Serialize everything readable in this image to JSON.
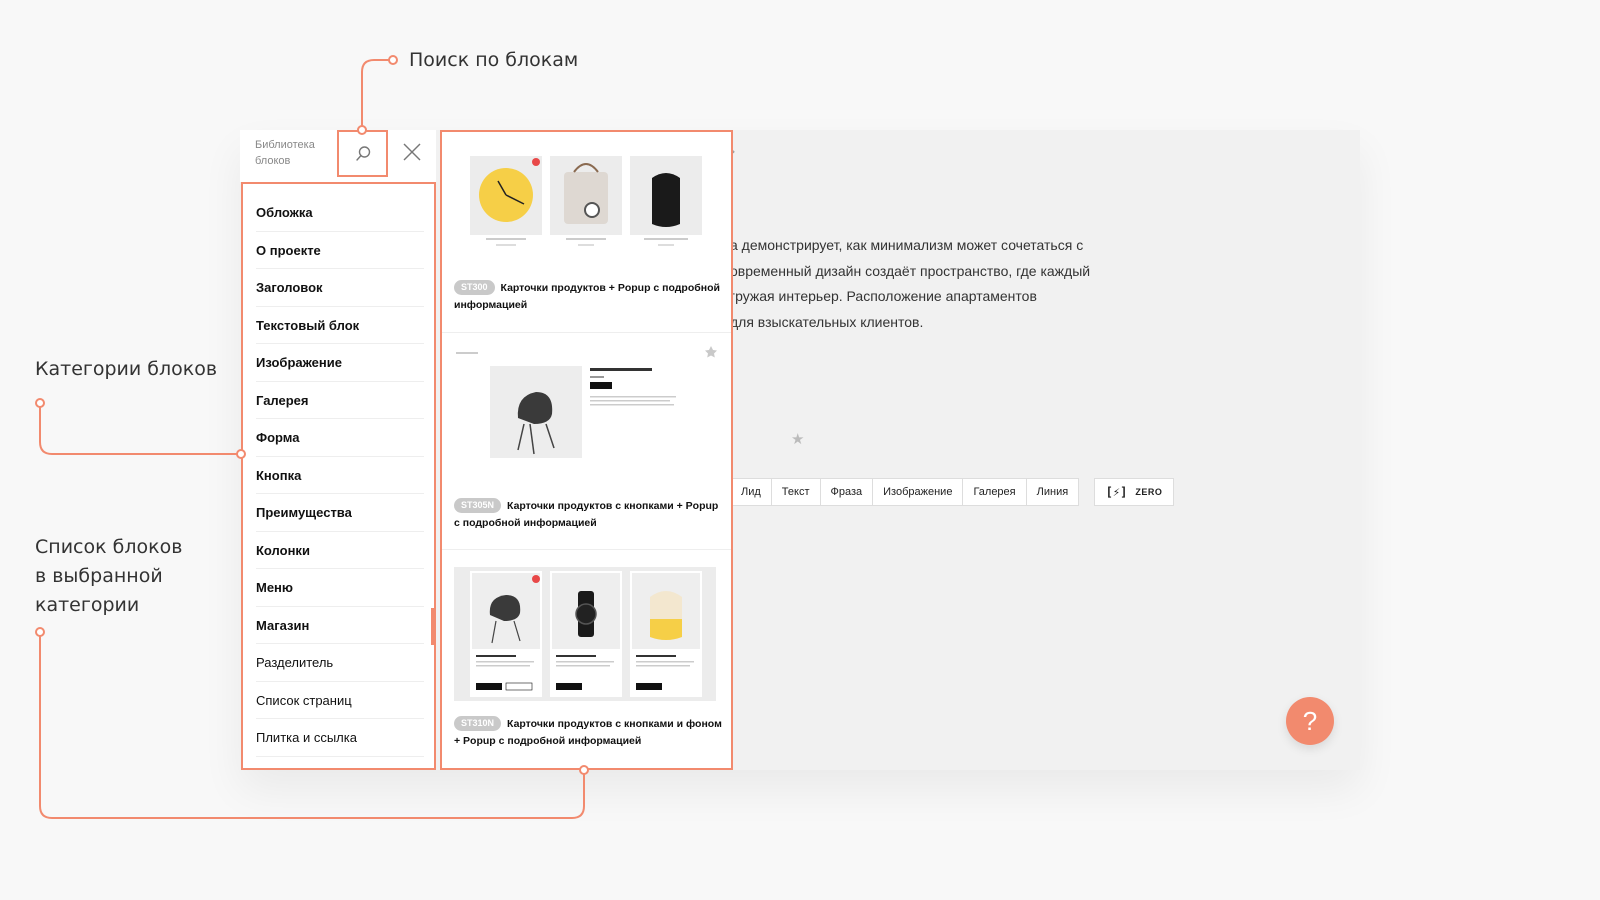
{
  "annotations": {
    "search": "Поиск по блокам",
    "categories": "Категории блоков",
    "list": "Список блоков\nв выбранной\nкатегории"
  },
  "colors": {
    "accent": "#f28a6e"
  },
  "library": {
    "title": "Библиотека\nблоков",
    "search_icon": "search-icon",
    "close_icon": "close-icon"
  },
  "categories": [
    {
      "label": "Обложка",
      "bold": true
    },
    {
      "label": "О проекте",
      "bold": true
    },
    {
      "label": "Заголовок",
      "bold": true
    },
    {
      "label": "Текстовый блок",
      "bold": true
    },
    {
      "label": "Изображение",
      "bold": true
    },
    {
      "label": "Галерея",
      "bold": true
    },
    {
      "label": "Форма",
      "bold": true
    },
    {
      "label": "Кнопка",
      "bold": true
    },
    {
      "label": "Преимущества",
      "bold": true
    },
    {
      "label": "Колонки",
      "bold": true
    },
    {
      "label": "Меню",
      "bold": true
    },
    {
      "label": "Магазин",
      "bold": true,
      "selected": true
    },
    {
      "label": "Разделитель",
      "bold": false
    },
    {
      "label": "Список страниц",
      "bold": false
    },
    {
      "label": "Плитка и ссылка",
      "bold": false
    }
  ],
  "blocks": [
    {
      "code": "ST300",
      "title": "Карточки продуктов + Popup с подробной информацией"
    },
    {
      "code": "ST305N",
      "title": "Карточки продуктов с кнопками + Popup с подробной информацией"
    },
    {
      "code": "ST310N",
      "title": "Карточки продуктов с кнопками и фоном + Popup с подробной информацией"
    }
  ],
  "editor": {
    "text_lines": [
      "а демонстрирует, как минимализм может сочетаться с",
      "овременный дизайн создаёт пространство, где каждый",
      "гружая интерьер. Расположение апартаментов",
      " для взыскательных клиентов."
    ],
    "type_buttons": [
      "Лид",
      "Текст",
      "Фраза",
      "Изображение",
      "Галерея",
      "Линия"
    ],
    "zero_icon": "[⚡]",
    "zero_label": "ZERO",
    "help_label": "?"
  }
}
